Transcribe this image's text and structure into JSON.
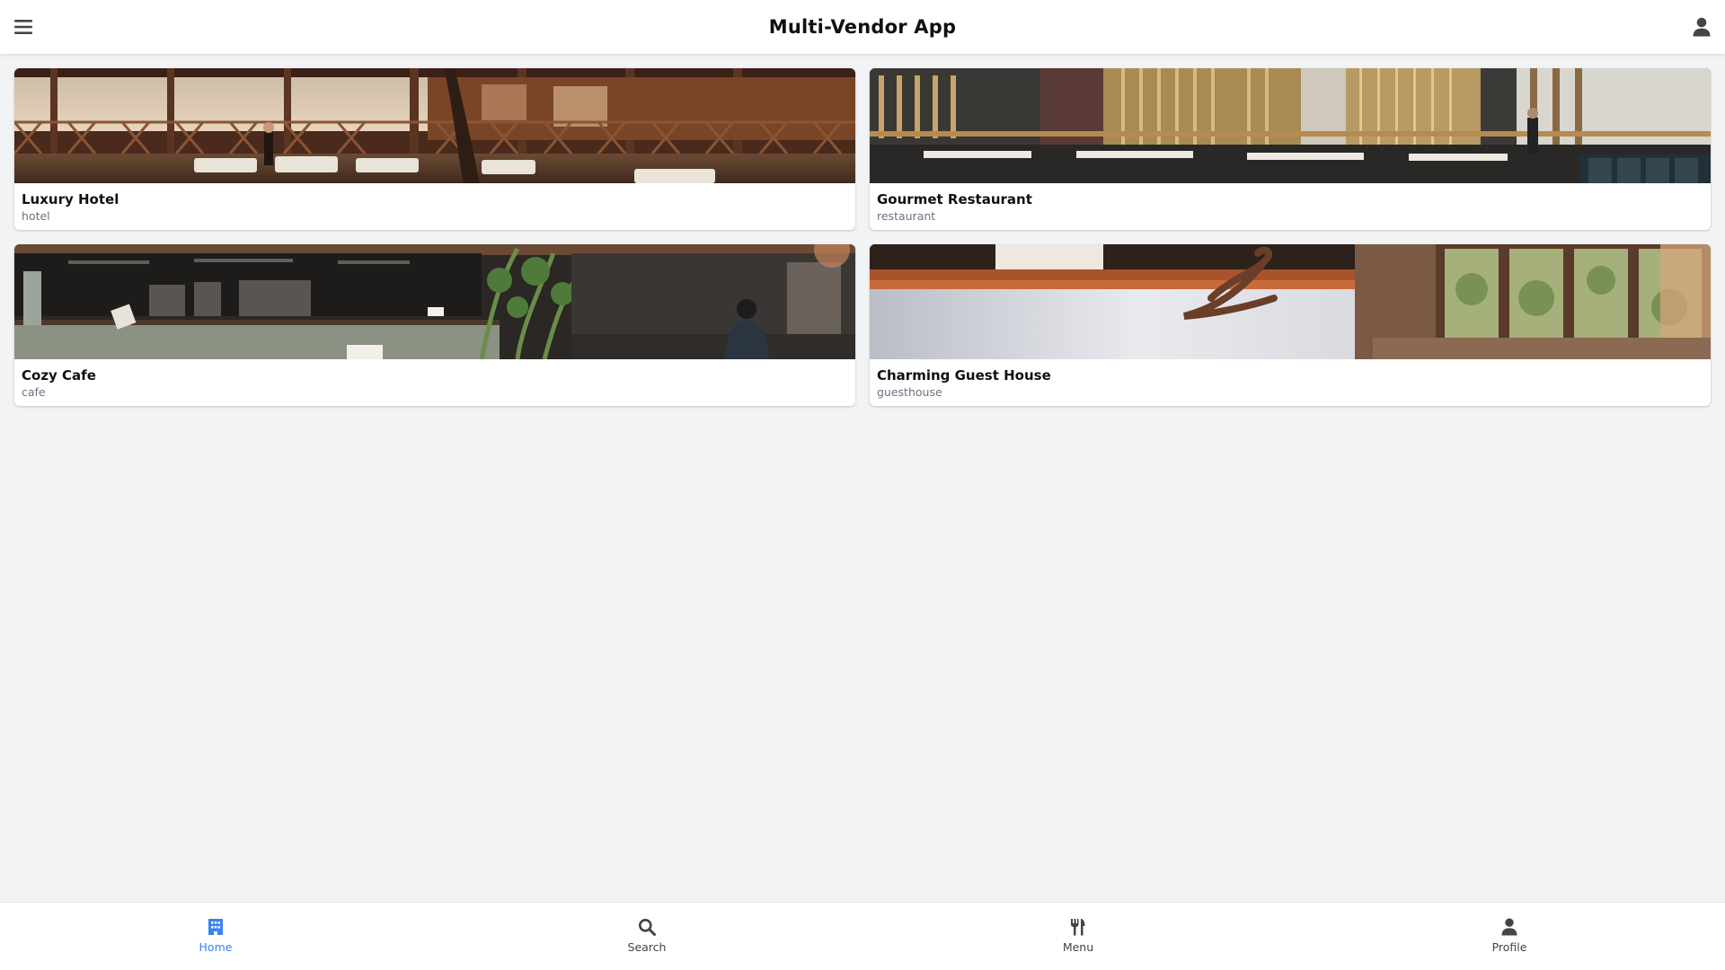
{
  "app": {
    "title": "Multi-Vendor App"
  },
  "header": {
    "menu_icon": "hamburger-menu-icon",
    "user_icon": "user-icon"
  },
  "vendors": [
    {
      "name": "Luxury Hotel",
      "type": "hotel"
    },
    {
      "name": "Gourmet Restaurant",
      "type": "restaurant"
    },
    {
      "name": "Cozy Cafe",
      "type": "cafe"
    },
    {
      "name": "Charming Guest House",
      "type": "guesthouse"
    }
  ],
  "bottom_nav": {
    "items": [
      {
        "label": "Home",
        "icon": "building-icon",
        "active": true
      },
      {
        "label": "Search",
        "icon": "search-icon",
        "active": false
      },
      {
        "label": "Menu",
        "icon": "utensils-icon",
        "active": false
      },
      {
        "label": "Profile",
        "icon": "user-icon",
        "active": false
      }
    ]
  },
  "colors": {
    "accent": "#3b82f6",
    "inactive": "#444444",
    "background": "#f2f3f5"
  }
}
